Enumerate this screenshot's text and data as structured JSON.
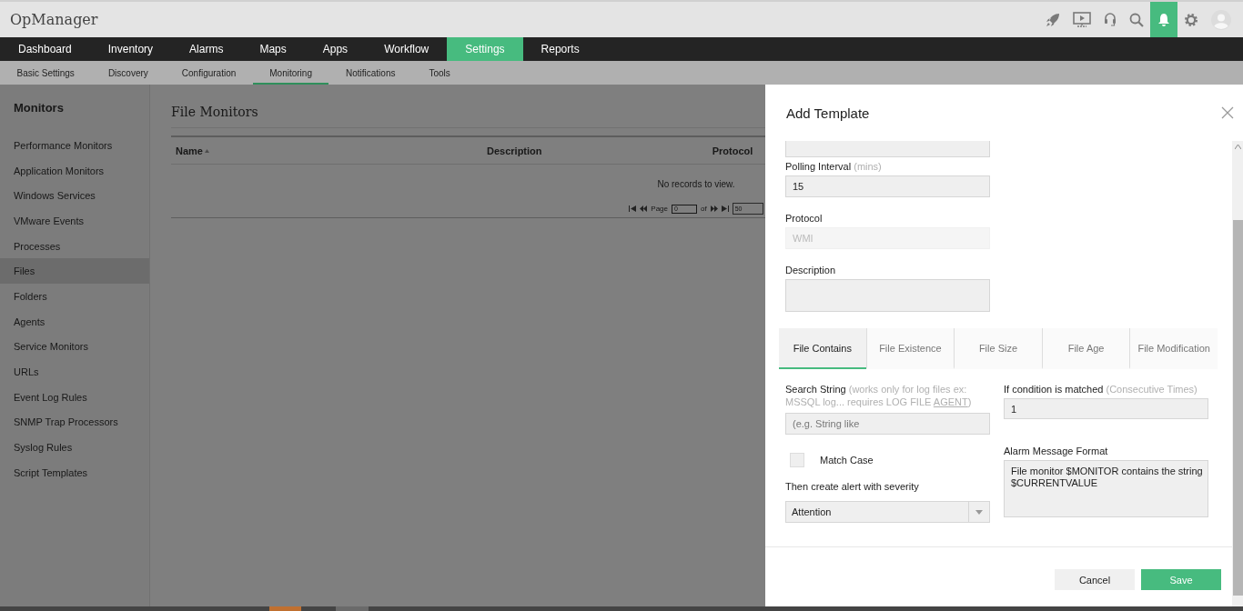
{
  "app": {
    "title": "OpManager"
  },
  "toolbar": [
    {
      "kind": "rocket",
      "selected": false
    },
    {
      "kind": "monitor",
      "selected": false
    },
    {
      "kind": "headset",
      "selected": false
    },
    {
      "kind": "search",
      "selected": false
    },
    {
      "kind": "bell",
      "selected": true
    },
    {
      "kind": "gear",
      "selected": false
    },
    {
      "kind": "avatar",
      "selected": false
    }
  ],
  "nav": [
    {
      "label": "Dashboard",
      "selected": false
    },
    {
      "label": "Inventory",
      "selected": false
    },
    {
      "label": "Alarms",
      "selected": false
    },
    {
      "label": "Maps",
      "selected": false
    },
    {
      "label": "Apps",
      "selected": false
    },
    {
      "label": "Workflow",
      "selected": false
    },
    {
      "label": "Settings",
      "selected": true
    },
    {
      "label": "Reports",
      "selected": false
    }
  ],
  "subnav": [
    {
      "label": "Basic Settings",
      "selected": false
    },
    {
      "label": "Discovery",
      "selected": false
    },
    {
      "label": "Configuration",
      "selected": false
    },
    {
      "label": "Monitoring",
      "selected": true
    },
    {
      "label": "Notifications",
      "selected": false
    },
    {
      "label": "Tools",
      "selected": false
    }
  ],
  "sidebar": {
    "title": "Monitors",
    "items": [
      {
        "label": "Performance Monitors",
        "selected": false
      },
      {
        "label": "Application Monitors",
        "selected": false
      },
      {
        "label": "Windows Services",
        "selected": false
      },
      {
        "label": "VMware Events",
        "selected": false
      },
      {
        "label": "Processes",
        "selected": false
      },
      {
        "label": "Files",
        "selected": true
      },
      {
        "label": "Folders",
        "selected": false
      },
      {
        "label": "Agents",
        "selected": false
      },
      {
        "label": "Service Monitors",
        "selected": false
      },
      {
        "label": "URLs",
        "selected": false
      },
      {
        "label": "Event Log Rules",
        "selected": false
      },
      {
        "label": "SNMP Trap Processors",
        "selected": false
      },
      {
        "label": "Syslog Rules",
        "selected": false
      },
      {
        "label": "Script Templates",
        "selected": false
      }
    ]
  },
  "content": {
    "title": "File Monitors",
    "columns": [
      "Name",
      "Description",
      "Protocol"
    ],
    "empty_message": "No records to view.",
    "pager": {
      "page_label": "Page",
      "page_value": "0",
      "of_label": "of",
      "page_size": "50"
    }
  },
  "dialog": {
    "title": "Add Template",
    "polling": {
      "label": "Polling Interval",
      "hint": "(mins)",
      "value": "15"
    },
    "protocol": {
      "label": "Protocol",
      "value": "WMI",
      "disabled": true
    },
    "description": {
      "label": "Description"
    },
    "tabs": [
      {
        "label": "File Contains",
        "selected": true
      },
      {
        "label": "File Existence",
        "selected": false
      },
      {
        "label": "File Size",
        "selected": false
      },
      {
        "label": "File Age",
        "selected": false
      },
      {
        "label": "File Modification",
        "selected": false
      }
    ],
    "search_string": {
      "label": "Search String",
      "hint": "(works only for log files ex: MSSQL log... requires LOG FILE",
      "link": "AGENT",
      "hint_end": ")",
      "placeholder": "(e.g. String like"
    },
    "match_case": {
      "label": "Match Case",
      "checked": false
    },
    "severity": {
      "label": "Then create alert with severity",
      "value": "Attention"
    },
    "condition": {
      "label": "If condition is matched",
      "hint": "(Consecutive Times)",
      "value": "1"
    },
    "alarm_format": {
      "label": "Alarm Message Format",
      "value": "File monitor $MONITOR contains the string $CURRENTVALUE"
    },
    "buttons": [
      {
        "label": "Cancel",
        "kind": "secondary"
      },
      {
        "label": "Save",
        "kind": "primary"
      }
    ]
  }
}
